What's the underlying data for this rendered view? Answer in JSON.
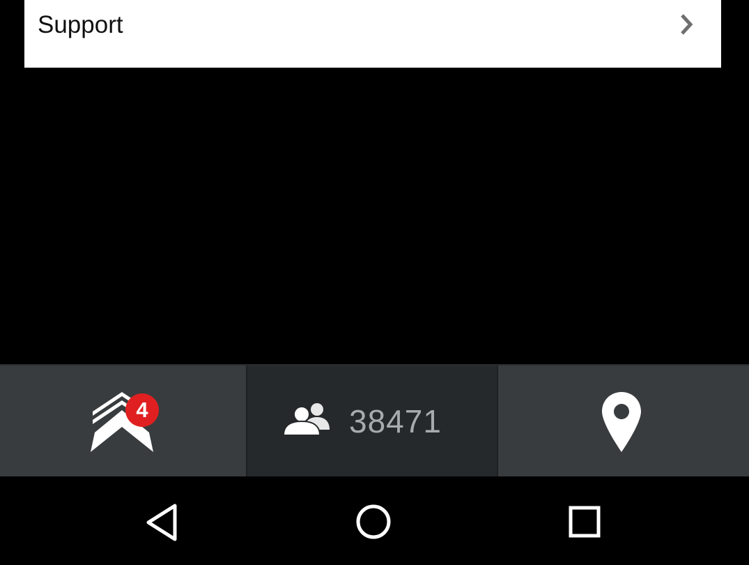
{
  "support_row": {
    "label": "Support",
    "chevron_icon": "chevron-right-icon"
  },
  "tab_bar": {
    "tabs": [
      {
        "id": "ranks",
        "icon": "rank-chevrons-icon",
        "badge_count": "4",
        "selected": false
      },
      {
        "id": "people",
        "icon": "people-icon",
        "count": "38471",
        "selected": true
      },
      {
        "id": "location",
        "icon": "map-pin-icon",
        "selected": false
      }
    ]
  },
  "nav_bar": {
    "buttons": [
      {
        "id": "back",
        "icon": "back-triangle-icon"
      },
      {
        "id": "home",
        "icon": "home-circle-icon"
      },
      {
        "id": "recents",
        "icon": "recents-square-icon"
      }
    ]
  },
  "colors": {
    "background": "#000000",
    "card": "#ffffff",
    "tab_bar": "#383c3f",
    "tab_selected": "#26292b",
    "badge": "#e02020",
    "count_text": "#a8abad"
  }
}
